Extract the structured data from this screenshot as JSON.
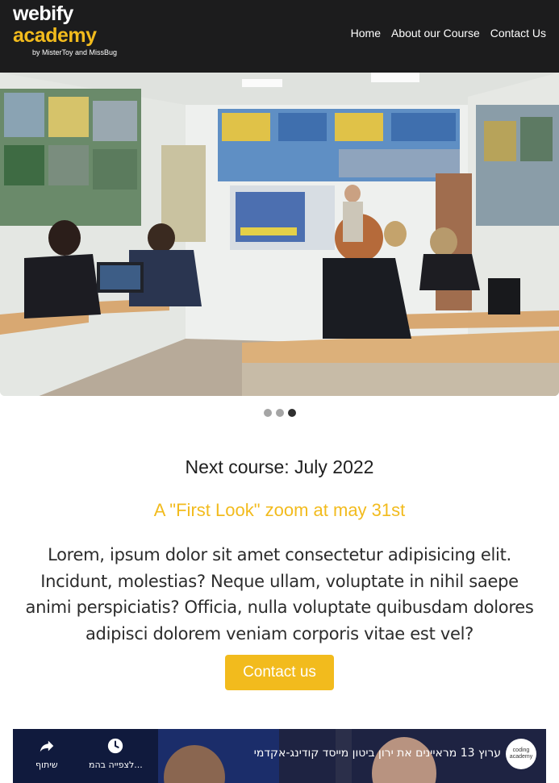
{
  "header": {
    "logo": {
      "line1": "webify",
      "line2": "academy",
      "tagline": "by MisterToy and MissBug"
    },
    "nav": [
      {
        "label": "Home"
      },
      {
        "label": "About our Course"
      },
      {
        "label": "Contact Us"
      }
    ]
  },
  "carousel": {
    "slide_count": 3,
    "active_index": 2
  },
  "main": {
    "next_course": "Next course: July 2022",
    "first_look": "A \"First Look\" zoom at may 31st",
    "description": "Lorem, ipsum dolor sit amet consectetur adipisicing elit. Incidunt, molestias? Neque ullam, voluptate in nihil saepe animi perspiciatis? Officia, nulla voluptate quibusdam dolores adipisci dolorem veniam corporis vitae est vel?",
    "cta_label": "Contact us"
  },
  "video": {
    "title": "ערוץ 13 מראיינים את ירון ביטון מייסד קודינג-אקדמי",
    "channel_badge": "coding academy",
    "share_label": "שיתוף",
    "watch_later_label": "לצפייה בהמ..."
  },
  "colors": {
    "accent": "#f2bb1d",
    "header_bg": "#1c1c1d",
    "text": "#2c2c2c"
  }
}
